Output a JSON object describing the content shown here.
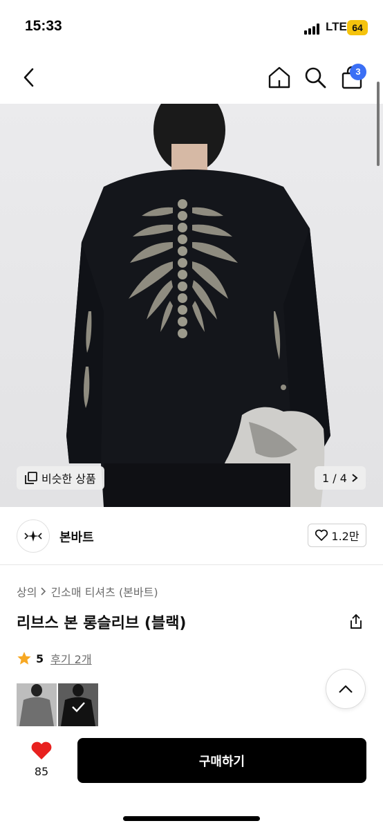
{
  "status_bar": {
    "time": "15:33",
    "network": "LTE",
    "battery": "64"
  },
  "nav": {
    "cart_count": "3"
  },
  "hero": {
    "similar_label": "비슷한 상품",
    "page_counter": "1 / 4"
  },
  "seller": {
    "name": "본바트",
    "likes": "1.2만"
  },
  "product": {
    "breadcrumb": [
      "상의",
      "긴소매 티셔츠 (본바트)"
    ],
    "title": "리브스 본 롱슬리브 (블랙)",
    "rating": "5",
    "reviews": "후기 2개"
  },
  "bottom": {
    "like_count": "85",
    "buy_label": "구매하기"
  },
  "colors": {
    "accent": "#3b6ff5",
    "heart": "#e8211f",
    "star": "#f7a823",
    "battery": "#f5c30d"
  }
}
